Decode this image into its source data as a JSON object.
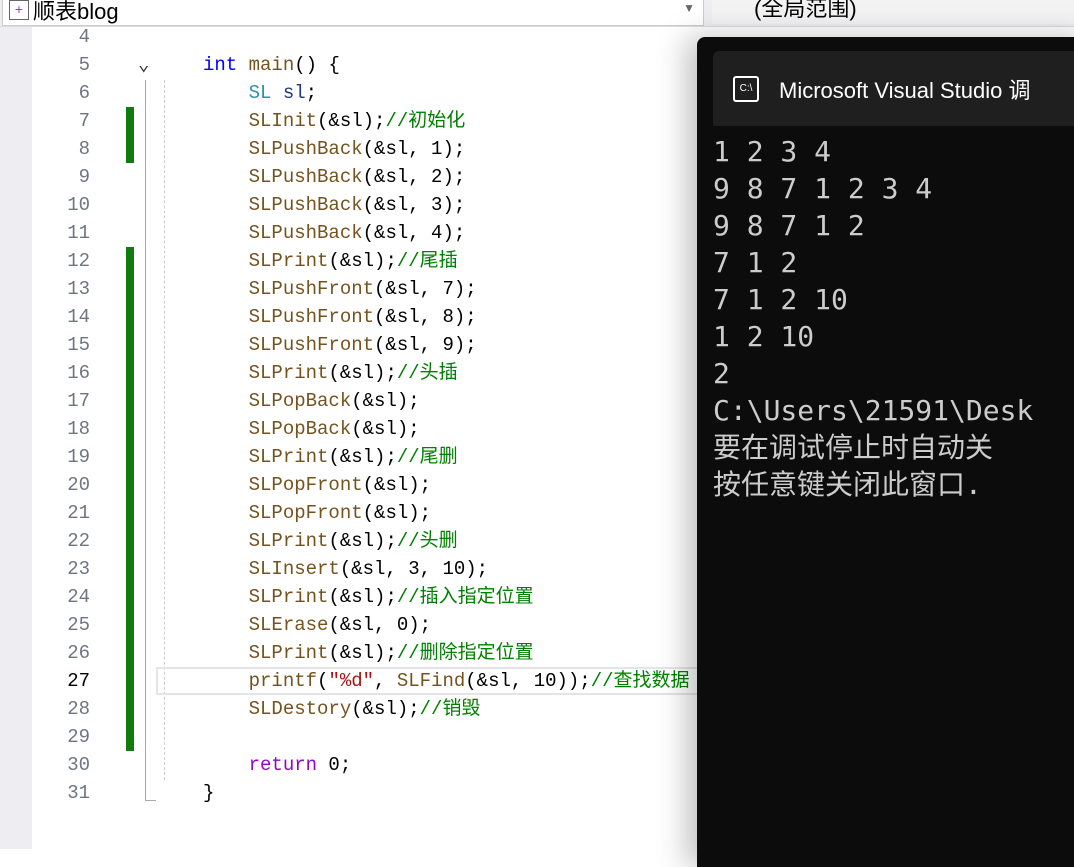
{
  "toolbar": {
    "project": "顺表blog",
    "scope": "(全局范围)"
  },
  "editor": {
    "lines": [
      {
        "n": "4",
        "t": []
      },
      {
        "n": "5",
        "t": [
          [
            "kw",
            "int"
          ],
          [
            "pl",
            " "
          ],
          [
            "fn",
            "main"
          ],
          [
            "pl",
            "() {"
          ]
        ]
      },
      {
        "n": "6",
        "t": [
          [
            "pl",
            "    "
          ],
          [
            "ty",
            "SL"
          ],
          [
            "pl",
            " "
          ],
          [
            "id",
            "sl"
          ],
          [
            "pl",
            ";"
          ]
        ]
      },
      {
        "n": "7",
        "t": [
          [
            "pl",
            "    "
          ],
          [
            "fn",
            "SLInit"
          ],
          [
            "pl",
            "(&sl);"
          ],
          [
            "cm",
            "//初始化"
          ]
        ]
      },
      {
        "n": "8",
        "t": [
          [
            "pl",
            "    "
          ],
          [
            "fn",
            "SLPushBack"
          ],
          [
            "pl",
            "(&sl, 1);"
          ]
        ]
      },
      {
        "n": "9",
        "t": [
          [
            "pl",
            "    "
          ],
          [
            "fn",
            "SLPushBack"
          ],
          [
            "pl",
            "(&sl, 2);"
          ]
        ]
      },
      {
        "n": "10",
        "t": [
          [
            "pl",
            "    "
          ],
          [
            "fn",
            "SLPushBack"
          ],
          [
            "pl",
            "(&sl, 3);"
          ]
        ]
      },
      {
        "n": "11",
        "t": [
          [
            "pl",
            "    "
          ],
          [
            "fn",
            "SLPushBack"
          ],
          [
            "pl",
            "(&sl, 4);"
          ]
        ]
      },
      {
        "n": "12",
        "t": [
          [
            "pl",
            "    "
          ],
          [
            "fn",
            "SLPrint"
          ],
          [
            "pl",
            "(&sl);"
          ],
          [
            "cm",
            "//尾插"
          ]
        ]
      },
      {
        "n": "13",
        "t": [
          [
            "pl",
            "    "
          ],
          [
            "fn",
            "SLPushFront"
          ],
          [
            "pl",
            "(&sl, 7);"
          ]
        ]
      },
      {
        "n": "14",
        "t": [
          [
            "pl",
            "    "
          ],
          [
            "fn",
            "SLPushFront"
          ],
          [
            "pl",
            "(&sl, 8);"
          ]
        ]
      },
      {
        "n": "15",
        "t": [
          [
            "pl",
            "    "
          ],
          [
            "fn",
            "SLPushFront"
          ],
          [
            "pl",
            "(&sl, 9);"
          ]
        ]
      },
      {
        "n": "16",
        "t": [
          [
            "pl",
            "    "
          ],
          [
            "fn",
            "SLPrint"
          ],
          [
            "pl",
            "(&sl);"
          ],
          [
            "cm",
            "//头插"
          ]
        ]
      },
      {
        "n": "17",
        "t": [
          [
            "pl",
            "    "
          ],
          [
            "fn",
            "SLPopBack"
          ],
          [
            "pl",
            "(&sl);"
          ]
        ]
      },
      {
        "n": "18",
        "t": [
          [
            "pl",
            "    "
          ],
          [
            "fn",
            "SLPopBack"
          ],
          [
            "pl",
            "(&sl);"
          ]
        ]
      },
      {
        "n": "19",
        "t": [
          [
            "pl",
            "    "
          ],
          [
            "fn",
            "SLPrint"
          ],
          [
            "pl",
            "(&sl);"
          ],
          [
            "cm",
            "//尾删"
          ]
        ]
      },
      {
        "n": "20",
        "t": [
          [
            "pl",
            "    "
          ],
          [
            "fn",
            "SLPopFront"
          ],
          [
            "pl",
            "(&sl);"
          ]
        ]
      },
      {
        "n": "21",
        "t": [
          [
            "pl",
            "    "
          ],
          [
            "fn",
            "SLPopFront"
          ],
          [
            "pl",
            "(&sl);"
          ]
        ]
      },
      {
        "n": "22",
        "t": [
          [
            "pl",
            "    "
          ],
          [
            "fn",
            "SLPrint"
          ],
          [
            "pl",
            "(&sl);"
          ],
          [
            "cm",
            "//头删"
          ]
        ]
      },
      {
        "n": "23",
        "t": [
          [
            "pl",
            "    "
          ],
          [
            "fn",
            "SLInsert"
          ],
          [
            "pl",
            "(&sl, 3, 10);"
          ]
        ]
      },
      {
        "n": "24",
        "t": [
          [
            "pl",
            "    "
          ],
          [
            "fn",
            "SLPrint"
          ],
          [
            "pl",
            "(&sl);"
          ],
          [
            "cm",
            "//插入指定位置"
          ]
        ]
      },
      {
        "n": "25",
        "t": [
          [
            "pl",
            "    "
          ],
          [
            "fn",
            "SLErase"
          ],
          [
            "pl",
            "(&sl, 0);"
          ]
        ]
      },
      {
        "n": "26",
        "t": [
          [
            "pl",
            "    "
          ],
          [
            "fn",
            "SLPrint"
          ],
          [
            "pl",
            "(&sl);"
          ],
          [
            "cm",
            "//删除指定位置"
          ]
        ]
      },
      {
        "n": "27",
        "t": [
          [
            "pl",
            "    "
          ],
          [
            "fn",
            "printf"
          ],
          [
            "pl",
            "("
          ],
          [
            "st",
            "\"%d\""
          ],
          [
            "pl",
            ", "
          ],
          [
            "fn",
            "SLFind"
          ],
          [
            "pl",
            "(&sl, 10));"
          ],
          [
            "cm",
            "//查找数据"
          ]
        ]
      },
      {
        "n": "28",
        "t": [
          [
            "pl",
            "    "
          ],
          [
            "fn",
            "SLDestory"
          ],
          [
            "pl",
            "(&sl);"
          ],
          [
            "cm",
            "//销毁"
          ]
        ]
      },
      {
        "n": "29",
        "t": []
      },
      {
        "n": "30",
        "t": [
          [
            "pl",
            "    "
          ],
          [
            "rk",
            "return"
          ],
          [
            "pl",
            " 0;"
          ]
        ]
      },
      {
        "n": "31",
        "t": [
          [
            "pl",
            "}"
          ]
        ]
      }
    ]
  },
  "console": {
    "title": "Microsoft Visual Studio 调",
    "lines": [
      "1 2 3 4",
      "9 8 7 1 2 3 4",
      "9 8 7 1 2",
      "7 1 2",
      "7 1 2 10",
      "1 2 10",
      "2",
      "C:\\Users\\21591\\Desk",
      "要在调试停止时自动关",
      "按任意键关闭此窗口."
    ]
  }
}
